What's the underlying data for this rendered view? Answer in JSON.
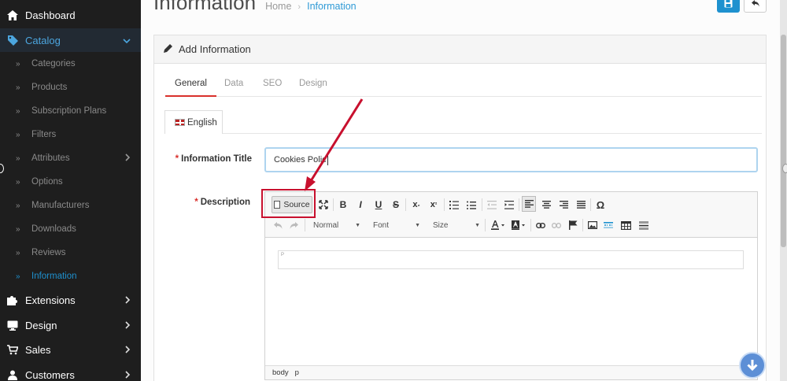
{
  "sidebar": {
    "items": [
      {
        "label": "Dashboard",
        "icon": "home-icon"
      },
      {
        "label": "Catalog",
        "icon": "tag-icon",
        "expanded": true
      },
      {
        "label": "Extensions",
        "icon": "puzzle-icon"
      },
      {
        "label": "Design",
        "icon": "monitor-icon"
      },
      {
        "label": "Sales",
        "icon": "cart-icon"
      },
      {
        "label": "Customers",
        "icon": "user-icon"
      }
    ],
    "catalog_items": [
      {
        "label": "Categories"
      },
      {
        "label": "Products"
      },
      {
        "label": "Subscription Plans"
      },
      {
        "label": "Filters"
      },
      {
        "label": "Attributes"
      },
      {
        "label": "Options"
      },
      {
        "label": "Manufacturers"
      },
      {
        "label": "Downloads"
      },
      {
        "label": "Reviews"
      },
      {
        "label": "Information"
      }
    ]
  },
  "header": {
    "title": "Information",
    "breadcrumb": [
      "Home",
      "Information"
    ]
  },
  "panel": {
    "title": "Add Information",
    "tabs": [
      "General",
      "Data",
      "SEO",
      "Design"
    ],
    "active_tab": "General",
    "language_tab": "English"
  },
  "form": {
    "title_label": "Information Title",
    "title_value": "Cookies Polic",
    "description_label": "Description",
    "required_mark": "*"
  },
  "editor": {
    "source_label": "Source",
    "bold": "B",
    "italic": "I",
    "underline": "U",
    "strike": "S",
    "omega": "Ω",
    "format_select": "Normal",
    "font_select": "Font",
    "size_select": "Size",
    "content_marker": "P",
    "status_path": [
      "body",
      "p"
    ]
  },
  "colors": {
    "accent": "#1e91cf",
    "sidebar_bg": "#1e1e1e",
    "highlight_red": "#c8102e",
    "active_tab_underline": "#d9302c"
  }
}
